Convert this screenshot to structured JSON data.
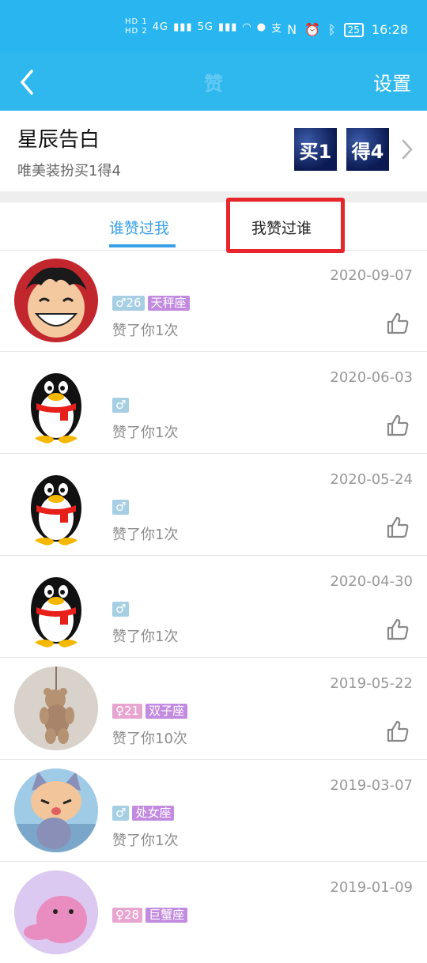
{
  "status_bar": {
    "hd1": "HD 1",
    "hd2": "HD 2",
    "net1": "4G",
    "net2": "5G",
    "battery": "25",
    "time": "16:28"
  },
  "header": {
    "title": "赞",
    "settings_label": "设置"
  },
  "promo": {
    "title": "星辰告白",
    "subtitle": "唯美装扮买1得4",
    "badge1": "买1",
    "badge2": "得4"
  },
  "tabs": {
    "who_liked_me": "谁赞过我",
    "who_i_liked": "我赞过谁"
  },
  "rows": [
    {
      "date": "2020-09-07",
      "gender": "♂",
      "age": "26",
      "zodiac": "天秤座",
      "liked_text": "赞了你1次"
    },
    {
      "date": "2020-06-03",
      "gender": "♂",
      "age": "",
      "zodiac": "",
      "liked_text": "赞了你1次"
    },
    {
      "date": "2020-05-24",
      "gender": "♂",
      "age": "",
      "zodiac": "",
      "liked_text": "赞了你1次"
    },
    {
      "date": "2020-04-30",
      "gender": "♂",
      "age": "",
      "zodiac": "",
      "liked_text": "赞了你1次"
    },
    {
      "date": "2019-05-22",
      "gender": "♀",
      "age": "21",
      "zodiac": "双子座",
      "liked_text": "赞了你10次"
    },
    {
      "date": "2019-03-07",
      "gender": "♂",
      "age": "",
      "zodiac": "处女座",
      "liked_text": "赞了你1次"
    },
    {
      "date": "2019-01-09",
      "gender": "♀",
      "age": "28",
      "zodiac": "巨蟹座",
      "liked_text": ""
    }
  ]
}
